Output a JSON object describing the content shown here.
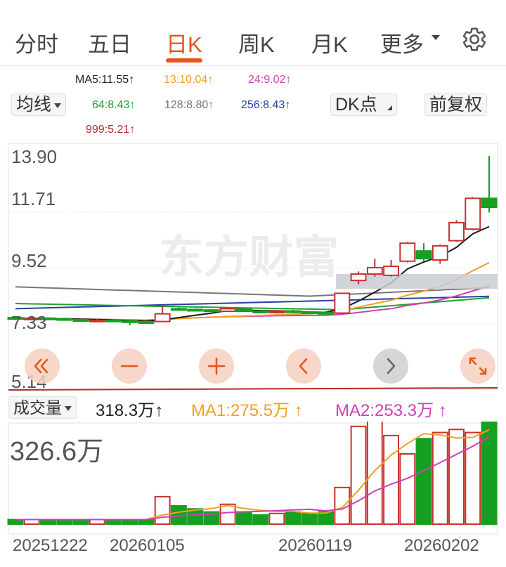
{
  "tabs": [
    {
      "label": "分时",
      "active": false
    },
    {
      "label": "五日",
      "active": false
    },
    {
      "label": "日K",
      "active": true
    },
    {
      "label": "周K",
      "active": false
    },
    {
      "label": "月K",
      "active": false
    }
  ],
  "tab_more": "更多",
  "ma_legend": {
    "ma5": "MA5:11.55",
    "ma13": "13:10.04",
    "ma24": "24:9.02",
    "ma64": "64:8.43",
    "ma128": "128:8.80",
    "ma256": "256:8.43",
    "ma999": "999:5.21",
    "arrow": "↑"
  },
  "buttons": {
    "avg_line": "均线",
    "dk_point": "DK点",
    "adjust": "前复权"
  },
  "watermark": "东方财富",
  "price_axis": [
    "13.90",
    "11.71",
    "9.52",
    "7.33",
    "5.14"
  ],
  "volume": {
    "selector": "成交量",
    "value": "318.3万",
    "ma1": "MA1:275.5万",
    "ma2": "MA2:253.3万",
    "arrow": "↑",
    "axis_max": "326.6万"
  },
  "date_axis": [
    "20251222",
    "20260105",
    "20260119",
    "20260202"
  ],
  "nav_icons": [
    "rewind-icon",
    "zoom-out-icon",
    "zoom-in-icon",
    "prev-icon",
    "next-icon",
    "fullscreen-icon"
  ],
  "colors": {
    "accent": "#e5561a",
    "up": "#c8312f",
    "down": "#16a021",
    "ma5": "#1a1a1a",
    "ma13": "#f0a020",
    "ma24": "#d03fb6",
    "ma64": "#20a030",
    "ma128": "#777777",
    "ma256": "#2a3fa0",
    "ma999": "#b82a2a",
    "vol_ma1": "#f0a020",
    "vol_ma2": "#d03fb6"
  },
  "chart_data": {
    "type": "candlestick",
    "price_range": [
      5.14,
      13.9
    ],
    "candles": [
      {
        "o": 7.6,
        "c": 7.55,
        "h": 7.65,
        "l": 7.5
      },
      {
        "o": 7.55,
        "c": 7.58,
        "h": 7.62,
        "l": 7.5
      },
      {
        "o": 7.58,
        "c": 7.56,
        "h": 7.62,
        "l": 7.52
      },
      {
        "o": 7.56,
        "c": 7.54,
        "h": 7.6,
        "l": 7.5
      },
      {
        "o": 7.52,
        "c": 7.48,
        "h": 7.56,
        "l": 7.45
      },
      {
        "o": 7.48,
        "c": 7.5,
        "h": 7.55,
        "l": 7.45
      },
      {
        "o": 7.5,
        "c": 7.47,
        "h": 7.53,
        "l": 7.42
      },
      {
        "o": 7.47,
        "c": 7.45,
        "h": 7.52,
        "l": 7.3
      },
      {
        "o": 7.44,
        "c": 7.43,
        "h": 7.48,
        "l": 7.4
      },
      {
        "o": 7.45,
        "c": 7.75,
        "h": 8.05,
        "l": 7.43
      },
      {
        "o": 7.95,
        "c": 7.92,
        "h": 8.0,
        "l": 7.88
      },
      {
        "o": 7.92,
        "c": 7.9,
        "h": 7.96,
        "l": 7.86
      },
      {
        "o": 7.9,
        "c": 7.88,
        "h": 7.93,
        "l": 7.85
      },
      {
        "o": 7.85,
        "c": 7.95,
        "h": 8.0,
        "l": 7.82
      },
      {
        "o": 7.95,
        "c": 7.85,
        "h": 7.98,
        "l": 7.82
      },
      {
        "o": 7.85,
        "c": 7.8,
        "h": 7.88,
        "l": 7.78
      },
      {
        "o": 7.8,
        "c": 7.85,
        "h": 7.9,
        "l": 7.76
      },
      {
        "o": 7.86,
        "c": 7.82,
        "h": 7.9,
        "l": 7.8
      },
      {
        "o": 7.82,
        "c": 7.78,
        "h": 7.86,
        "l": 7.75
      },
      {
        "o": 7.8,
        "c": 7.78,
        "h": 7.85,
        "l": 7.76
      },
      {
        "o": 7.78,
        "c": 8.55,
        "h": 8.55,
        "l": 7.75
      },
      {
        "o": 9.05,
        "c": 9.3,
        "h": 9.4,
        "l": 8.9
      },
      {
        "o": 9.3,
        "c": 9.55,
        "h": 9.9,
        "l": 9.2
      },
      {
        "o": 9.25,
        "c": 9.6,
        "h": 9.85,
        "l": 9.2
      },
      {
        "o": 9.8,
        "c": 10.5,
        "h": 10.55,
        "l": 9.75
      },
      {
        "o": 10.2,
        "c": 9.9,
        "h": 10.5,
        "l": 9.8
      },
      {
        "o": 9.85,
        "c": 10.4,
        "h": 10.45,
        "l": 9.7
      },
      {
        "o": 10.6,
        "c": 11.3,
        "h": 11.4,
        "l": 10.55
      },
      {
        "o": 11.05,
        "c": 12.25,
        "h": 12.3,
        "l": 11.0
      },
      {
        "o": 12.25,
        "c": 11.9,
        "h": 13.9,
        "l": 11.7
      }
    ],
    "volumes": [
      0.15,
      0.15,
      0.15,
      0.15,
      0.15,
      0.15,
      0.15,
      0.15,
      0.15,
      0.9,
      0.6,
      0.5,
      0.4,
      0.65,
      0.4,
      0.3,
      0.35,
      0.4,
      0.35,
      0.4,
      1.2,
      3.2,
      3.6,
      2.9,
      2.3,
      2.8,
      3.0,
      3.1,
      3.0,
      3.55
    ],
    "volume_range": [
      0,
      3.266
    ]
  }
}
